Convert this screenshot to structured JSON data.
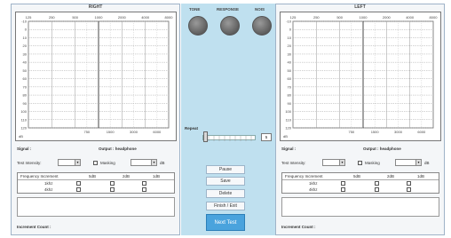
{
  "right_panel": {
    "title": "RIGHT",
    "freq_ticks_top": [
      "125",
      "250",
      "500",
      "1000",
      "2000",
      "4000",
      "8000"
    ],
    "freq_ticks_bottom": [
      "750",
      "1500",
      "3000",
      "6000"
    ],
    "db_ticks": [
      "-10",
      "0",
      "10",
      "20",
      "30",
      "40",
      "50",
      "60",
      "70",
      "80",
      "90",
      "100",
      "110",
      "120"
    ],
    "axis_label": "dB",
    "signal_label": "Signal :",
    "output_label": "Output : headphone",
    "test_intensity_label": "Test Intensity:",
    "masking_label": "Masking",
    "db_unit": "dB",
    "freq_increment_label": "Frequency Increment",
    "col_5db": "5dB",
    "col_2db": "2dB",
    "col_1db": "1dB",
    "row_1khz": "1khz",
    "row_4khz": "4khz",
    "increment_count_label": "Increment Count :"
  },
  "left_panel": {
    "title": "LEFT",
    "freq_ticks_top": [
      "125",
      "250",
      "500",
      "1000",
      "2000",
      "4000",
      "8000"
    ],
    "freq_ticks_bottom": [
      "750",
      "1500",
      "3000",
      "6000"
    ],
    "db_ticks": [
      "-10",
      "0",
      "10",
      "20",
      "30",
      "40",
      "50",
      "60",
      "70",
      "80",
      "90",
      "100",
      "110",
      "120"
    ],
    "axis_label": "dB",
    "signal_label": "Signal :",
    "output_label": "Output : headphone",
    "test_intensity_label": "Test Intensity:",
    "masking_label": "Masking",
    "db_unit": "dB",
    "freq_increment_label": "Frequency Increment",
    "col_5db": "5dB",
    "col_2db": "2dB",
    "col_1db": "1dB",
    "row_1khz": "1khz",
    "row_4khz": "4khz",
    "increment_count_label": "Increment Count :"
  },
  "center": {
    "tone_label": "TONE",
    "response_label": "RESPONSE",
    "noise_label": "NOIS",
    "repeat_label": "Repeat",
    "repeat_value": "5",
    "pause_label": "Pause",
    "save_label": "Save",
    "delete_label": "Delete",
    "finish_exit_label": "Finish / Exit",
    "next_test_label": "Next Test"
  },
  "colors": {
    "center_bg": "#bfe0ef",
    "accent_button": "#4aa3dd",
    "indicator_lamp": "#5e5e5e"
  }
}
